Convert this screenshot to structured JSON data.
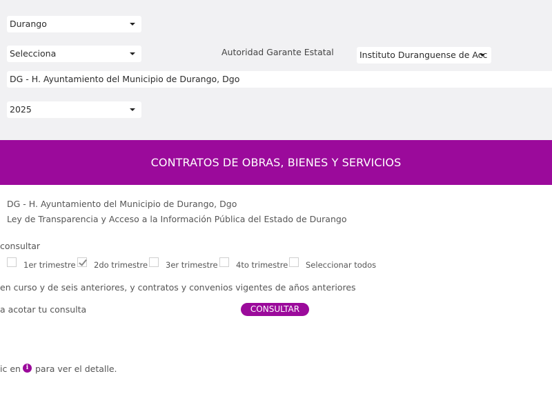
{
  "filters": {
    "state_select": {
      "value": "Durango"
    },
    "subject_select": {
      "value": "Selecciona"
    },
    "guarantor_label": "Autoridad Garante Estatal",
    "guarantor_select": {
      "value": "Instituto Duranguense de Acc"
    },
    "entity_select": {
      "value": "DG - H. Ayuntamiento del Municipio de Durango, Dgo"
    },
    "year_select": {
      "value": "2025"
    }
  },
  "banner": {
    "title": "CONTRATOS DE OBRAS, BIENES Y SERVICIOS"
  },
  "details": {
    "entity_name": "DG - H. Ayuntamiento del Municipio de Durango, Dgo",
    "law_name": "Ley de Transparencia y Acceso a la Información Pública del Estado de Durango"
  },
  "period": {
    "label": "consultar",
    "options": [
      {
        "label": "1er trimestre",
        "checked": false
      },
      {
        "label": "2do trimestre",
        "checked": true
      },
      {
        "label": "3er trimestre",
        "checked": false
      },
      {
        "label": "4to trimestre",
        "checked": false
      },
      {
        "label": "Seleccionar todos",
        "checked": false
      }
    ]
  },
  "info_text": "en curso y de seis anteriores, y contratos y convenios vigentes de años anteriores",
  "refine_text": "a acotar tu consulta",
  "consult_button": "CONSULTAR",
  "detail_hint": {
    "prefix": "ic en",
    "suffix": "para ver el detalle."
  },
  "colors": {
    "accent": "#9b0a9b",
    "panel_bg": "#f1f1f3"
  },
  "icons": {
    "info": "info-icon",
    "dropdown": "caret-down-icon"
  }
}
